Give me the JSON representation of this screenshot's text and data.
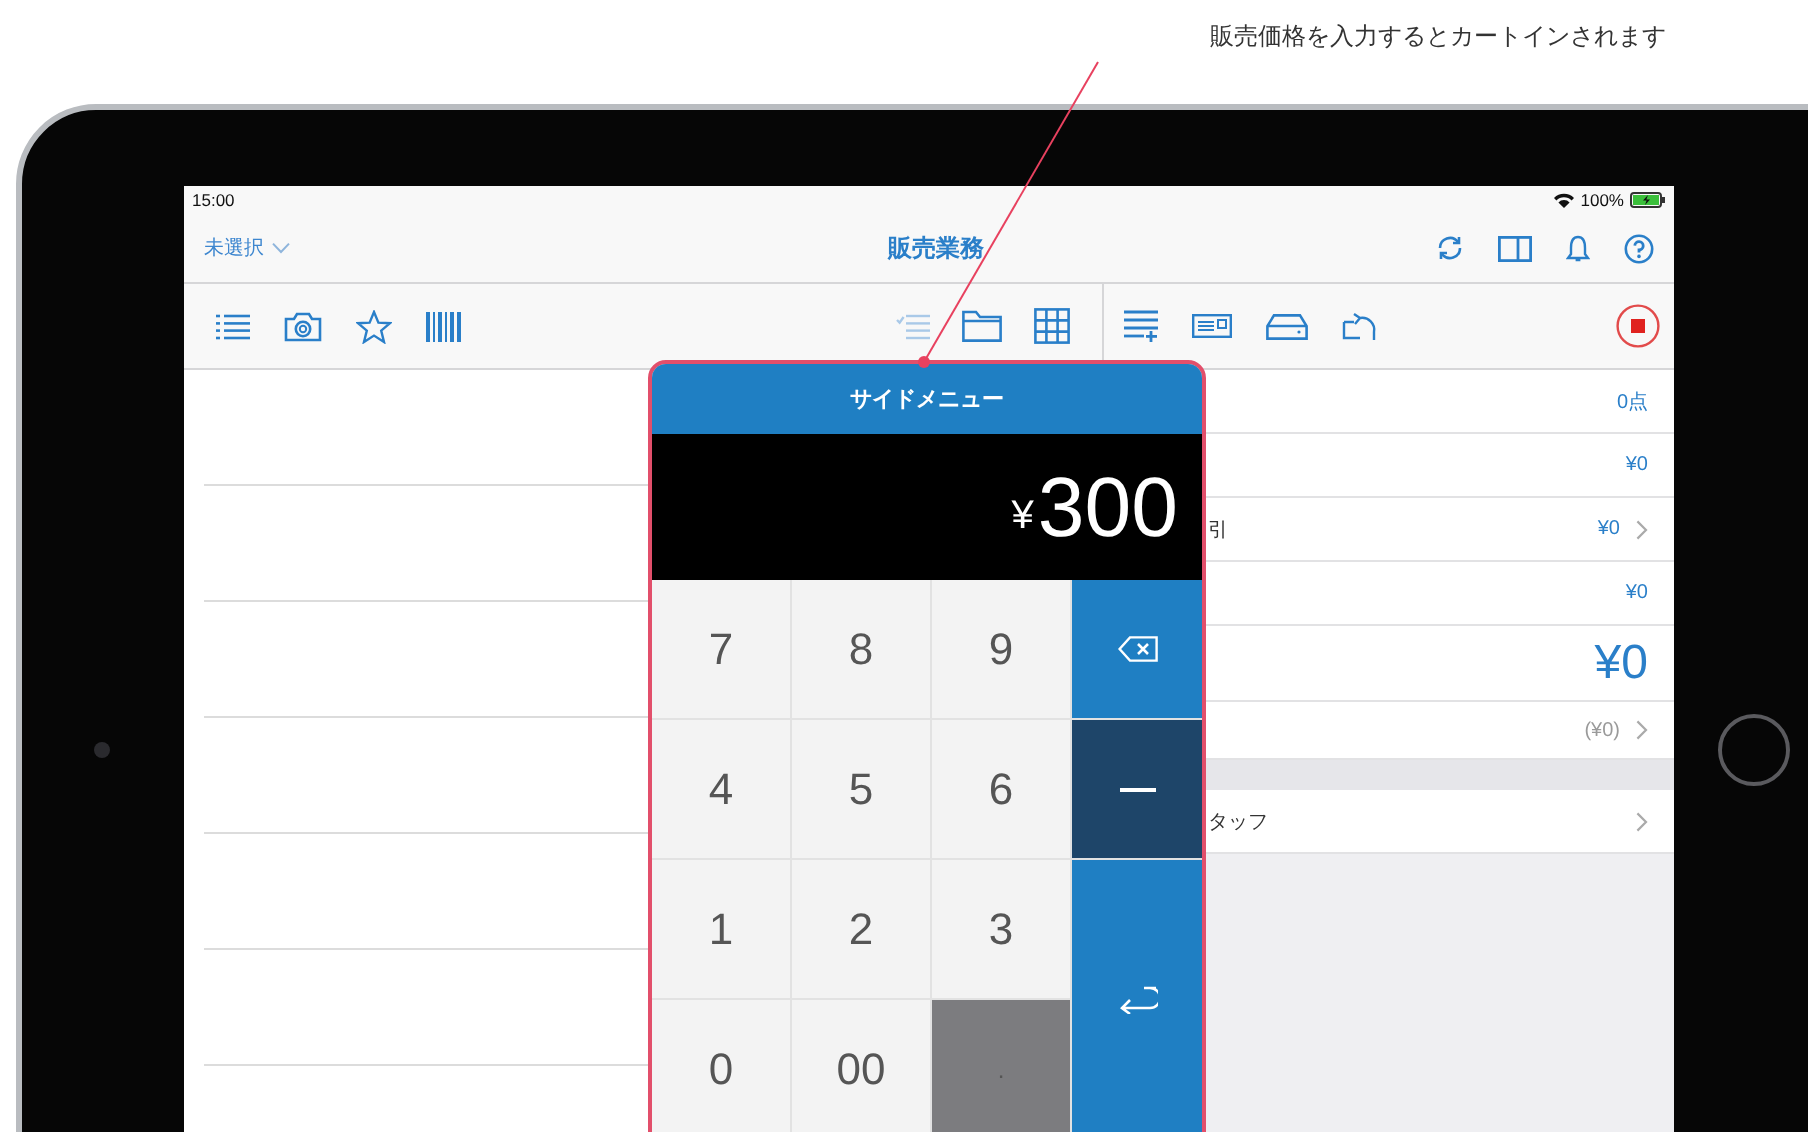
{
  "callout": "販売価格を入力するとカートインされます",
  "status_bar": {
    "time": "15:00",
    "battery": "100%"
  },
  "nav_bar": {
    "selector": "未選択",
    "title": "販売業務"
  },
  "summary_rows": [
    {
      "value": "0点",
      "chevron": false,
      "kind": "normal"
    },
    {
      "value": "¥0",
      "chevron": false,
      "kind": "normal"
    },
    {
      "label": "引",
      "value": "¥0",
      "chevron": true,
      "kind": "normal"
    },
    {
      "value": "¥0",
      "chevron": false,
      "kind": "normal"
    },
    {
      "value": "¥0",
      "chevron": false,
      "kind": "total"
    },
    {
      "value": "(¥0)",
      "chevron": true,
      "kind": "muted"
    }
  ],
  "staff_row": {
    "label": "タッフ",
    "chevron": true
  },
  "keypad": {
    "title": "サイドメニュー",
    "currency": "¥",
    "amount": "300",
    "keys": [
      {
        "kind": "digit",
        "label": "7"
      },
      {
        "kind": "digit",
        "label": "8"
      },
      {
        "kind": "digit",
        "label": "9"
      },
      {
        "kind": "backspace"
      },
      {
        "kind": "digit",
        "label": "4"
      },
      {
        "kind": "digit",
        "label": "5"
      },
      {
        "kind": "digit",
        "label": "6"
      },
      {
        "kind": "minus"
      },
      {
        "kind": "digit",
        "label": "1"
      },
      {
        "kind": "digit",
        "label": "2"
      },
      {
        "kind": "digit",
        "label": "3"
      },
      {
        "kind": "enter"
      },
      {
        "kind": "digit",
        "label": "0"
      },
      {
        "kind": "digit",
        "label": "00"
      },
      {
        "kind": "decimal",
        "label": "."
      }
    ]
  }
}
